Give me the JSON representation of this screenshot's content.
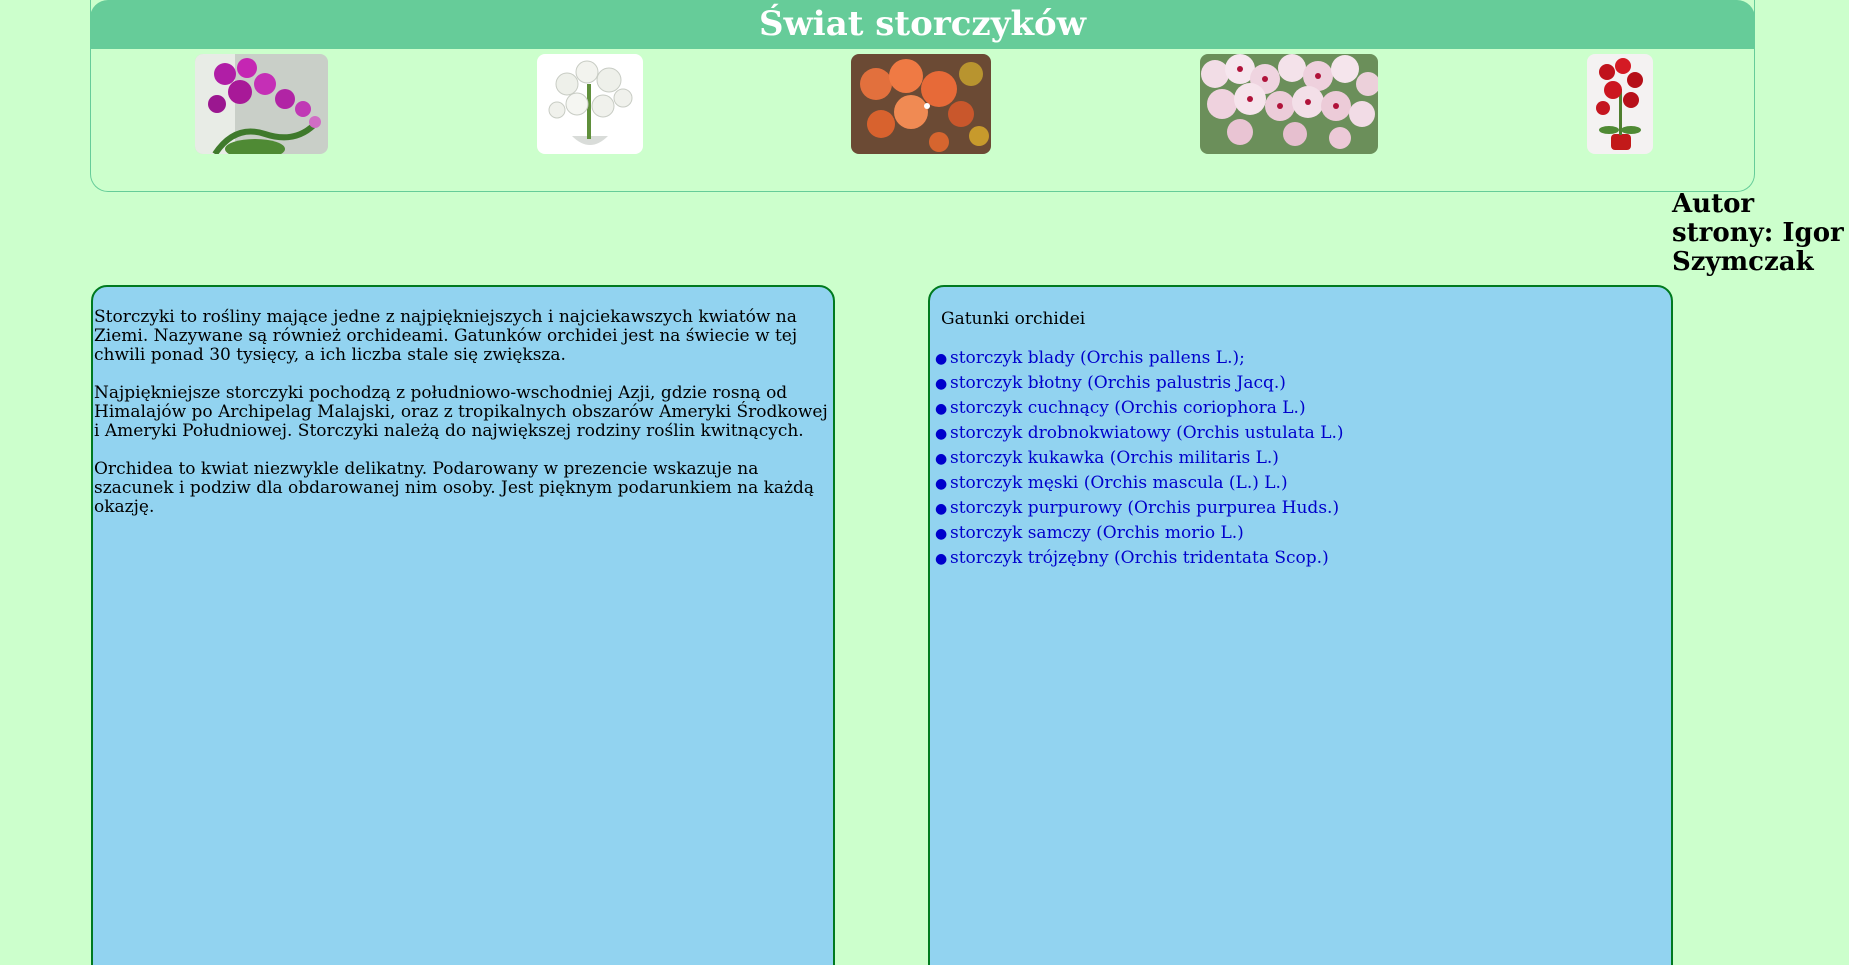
{
  "header": {
    "title": "Świat storczyków"
  },
  "gallery": [
    {
      "icon": "orchid-purple-photo"
    },
    {
      "icon": "orchid-white-pot-photo"
    },
    {
      "icon": "orchid-orange-photo"
    },
    {
      "icon": "orchid-pink-spotted-photo"
    },
    {
      "icon": "orchid-red-pot-photo"
    }
  ],
  "author": {
    "text": "Autor strony: Igor Szymczak"
  },
  "intro": {
    "paragraphs": [
      "Storczyki to rośliny mające jedne z najpiękniejszych i najciekawszych kwiatów na Ziemi. Nazywane są również orchideami. Gatunków orchidei jest na świecie w tej chwili ponad 30 tysięcy, a ich liczba stale się zwiększa.",
      "Najpiękniejsze storczyki pochodzą z południowo-wschodniej Azji, gdzie rosną od Himalajów po Archipelag Malajski, oraz z tropikalnych obszarów Ameryki Środkowej i Ameryki Południowej. Storczyki należą do największej rodziny roślin kwitnących.",
      "Orchidea to kwiat niezwykle delikatny. Podarowany w prezencie wskazuje na szacunek i podziw dla obdarowanej nim osoby. Jest pięknym podarunkiem na każdą okazję."
    ]
  },
  "species": {
    "title": "Gatunki orchidei",
    "items": [
      "storczyk blady (Orchis pallens L.);",
      "storczyk błotny (Orchis palustris Jacq.)",
      "storczyk cuchnący (Orchis coriophora L.)",
      "storczyk drobnokwiatowy (Orchis ustulata L.)",
      "storczyk kukawka (Orchis militaris L.)",
      "storczyk męski (Orchis mascula (L.) L.)",
      "storczyk purpurowy (Orchis purpurea Huds.)",
      "storczyk samczy (Orchis morio L.)",
      "storczyk trójzębny (Orchis tridentata Scop.)"
    ]
  },
  "colors": {
    "page_bg": "#ccffcc",
    "header_bar": "#66cc99",
    "panel_bg": "#92d3f0",
    "panel_border": "#007a1f",
    "link": "#0000cc"
  }
}
